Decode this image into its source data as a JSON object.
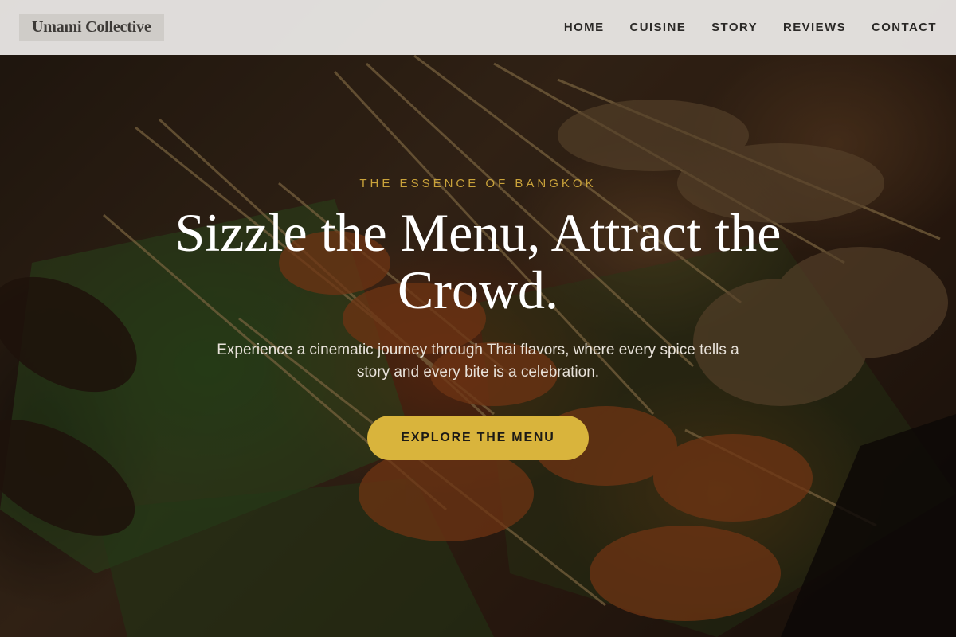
{
  "nav": {
    "brand": "Umami Collective",
    "links": [
      "HOME",
      "CUISINE",
      "STORY",
      "REVIEWS",
      "CONTACT"
    ]
  },
  "hero": {
    "eyebrow": "THE ESSENCE OF BANGKOK",
    "headline": "Sizzle the Menu, Attract the Crowd.",
    "subhead": "Experience a cinematic journey through Thai flavors, where every spice tells a story and every bite is a celebration.",
    "cta_label": "EXPLORE THE MENU"
  },
  "colors": {
    "accent": "#d9b43c",
    "eyebrow": "#c9a23a",
    "nav_background": "#eeecea",
    "brand_background": "#cfccc8",
    "text_light": "#ffffff"
  }
}
